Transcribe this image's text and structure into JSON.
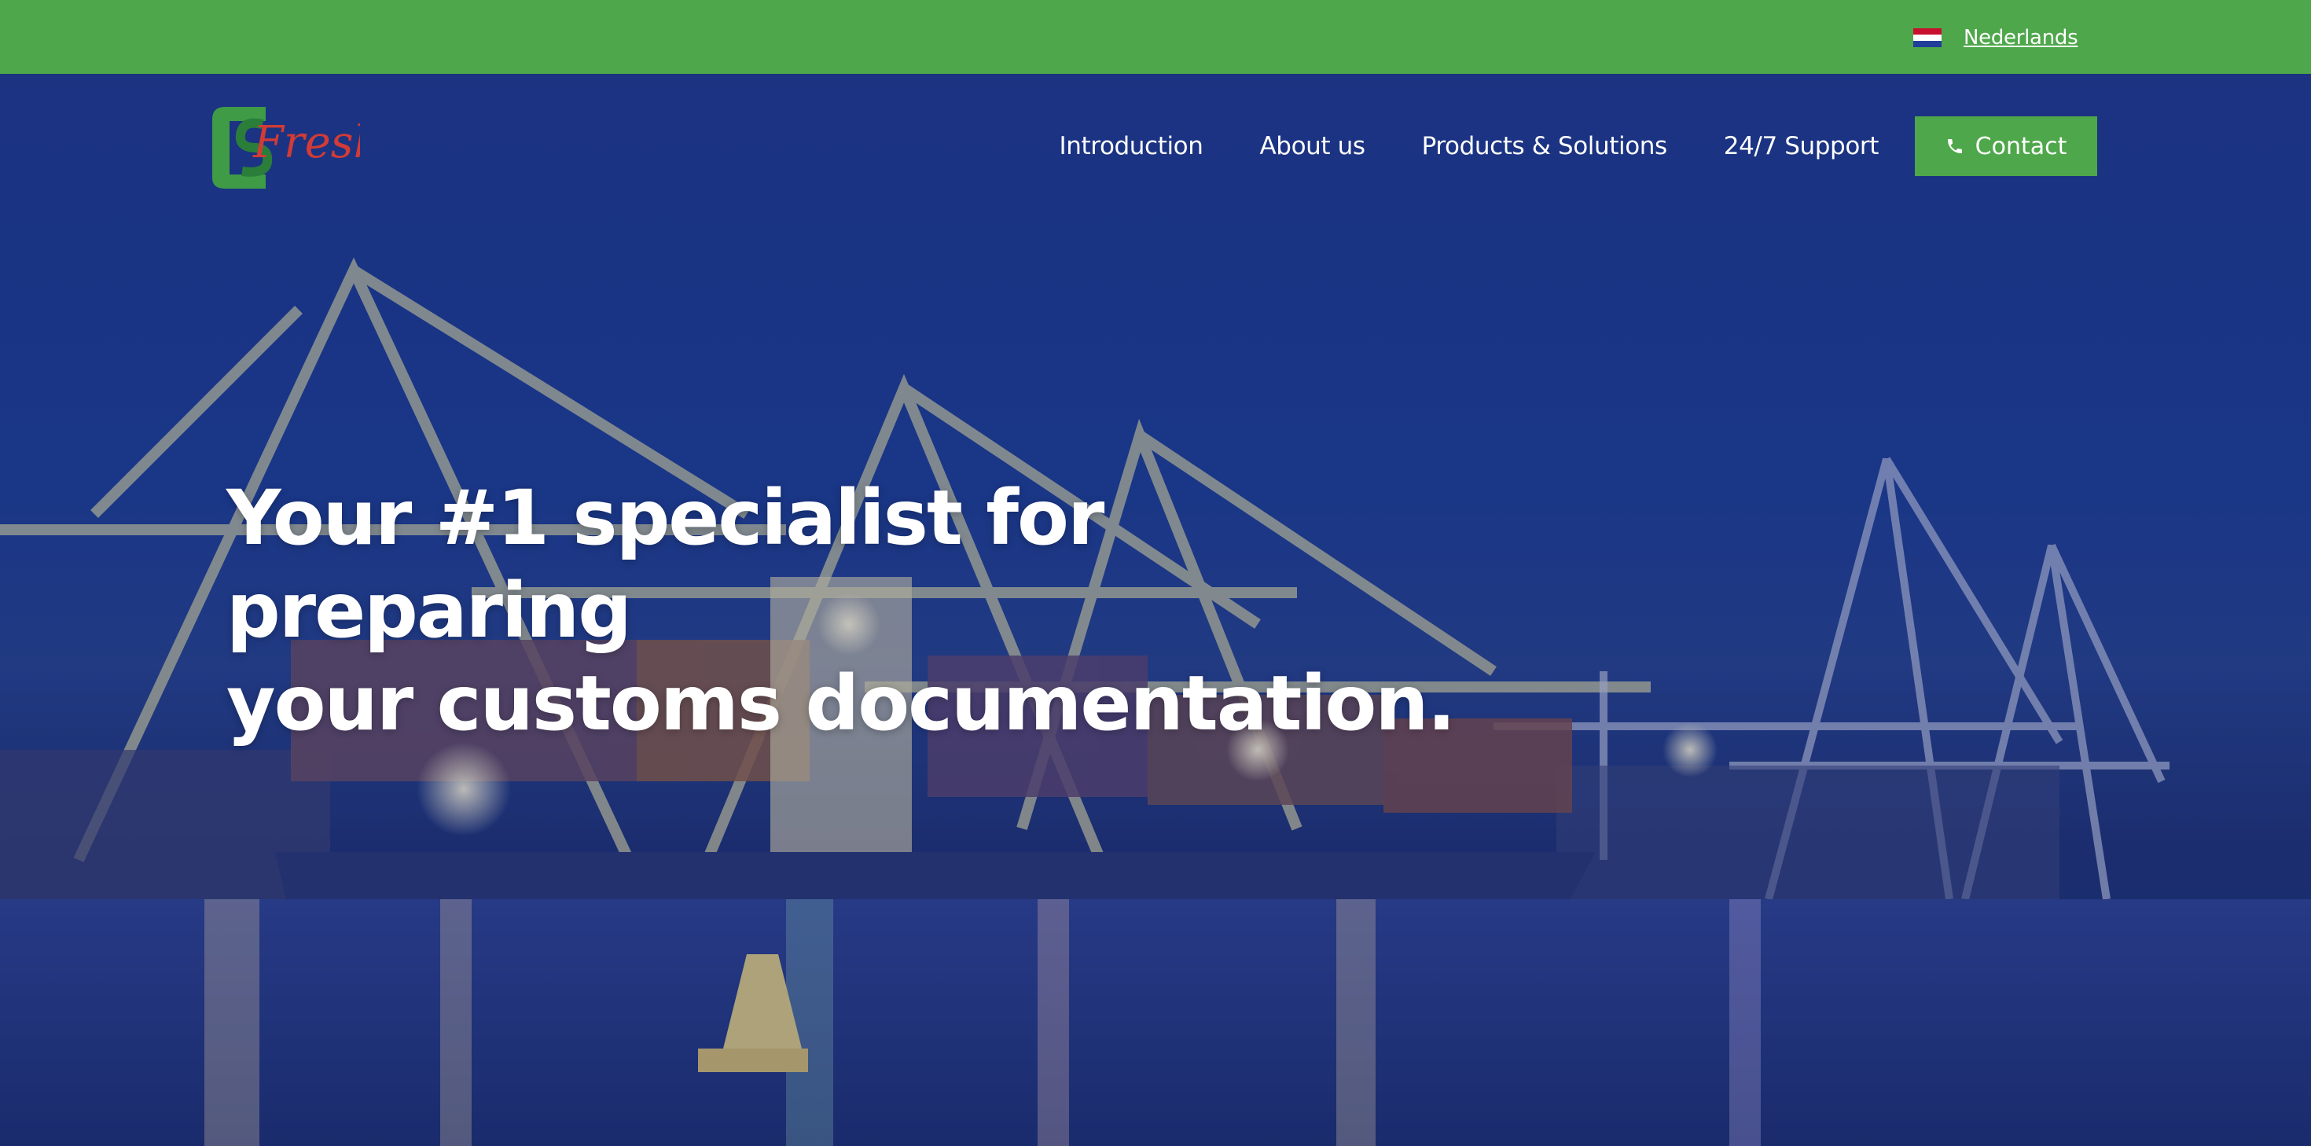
{
  "topbar": {
    "language_label": "Nederlands",
    "flag_icon": "netherlands-flag-icon",
    "bg_color": "#4ea74a"
  },
  "header": {
    "logo_text": "Fresh",
    "nav": [
      {
        "label": "Introduction"
      },
      {
        "label": "About us"
      },
      {
        "label": "Products & Solutions"
      },
      {
        "label": "24/7 Support"
      }
    ],
    "contact": {
      "label": "Contact",
      "icon": "phone-icon"
    }
  },
  "hero": {
    "headline_line1": "Your #1 specialist for preparing",
    "headline_line2": "your customs documentation."
  },
  "colors": {
    "accent": "#4ea74a",
    "hero_overlay": "#1a2f7a",
    "logo_red": "#d23b36"
  }
}
